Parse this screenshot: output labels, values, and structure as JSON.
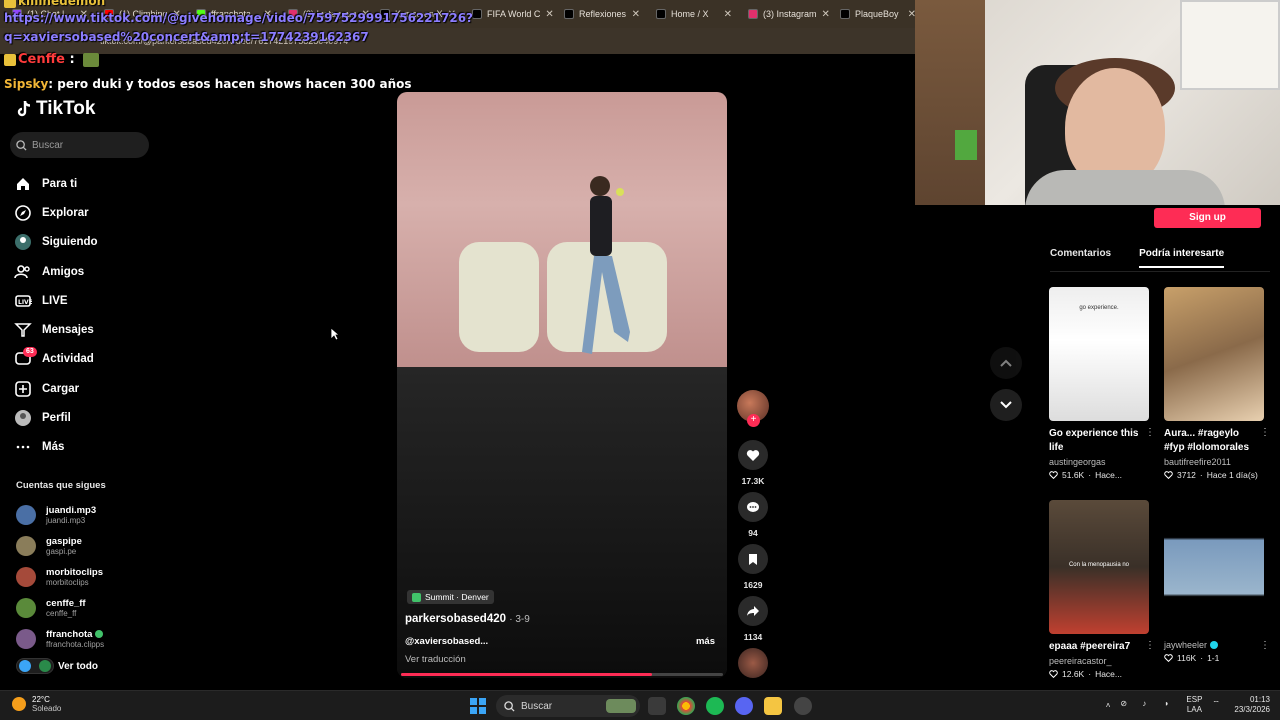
{
  "browser": {
    "tabs": [
      {
        "label": "(1) Chat | ...",
        "color": "#9147ff"
      },
      {
        "label": "(1) Climbing",
        "color": "#ff0000"
      },
      {
        "label": "ffranchota",
        "color": "#53fc18"
      },
      {
        "label": "(3) Instagram",
        "color": "#e1306c"
      },
      {
        "label": "Kurrco on X",
        "color": "#000000"
      },
      {
        "label": "FIFA World C",
        "color": "#000000"
      },
      {
        "label": "Reflexiones",
        "color": "#000000"
      },
      {
        "label": "Home / X",
        "color": "#000000"
      },
      {
        "label": "(3) Instagram",
        "color": "#e1306c"
      },
      {
        "label": "PlaqueBoy",
        "color": "#000000"
      }
    ],
    "url": "tiktok.com/@parkersobased420/video/7617421975828040974"
  },
  "chat": {
    "top_user": "kiiiinedemon",
    "url_line1": "https://www.tiktok.com/@givehomage/video/7597529991756221726?",
    "url_line2": "q=xaviersobased%20concert&amp;t=1774239162367",
    "line3_user": "Cenffe",
    "line3_sep": ":",
    "line4_user": "Sipsky",
    "line4_msg": ": pero duki y todos esos hacen shows hacen 300 años"
  },
  "tiktok": {
    "logo": "TikTok",
    "search_placeholder": "Buscar",
    "nav": [
      {
        "label": "Para ti",
        "icon": "home-icon"
      },
      {
        "label": "Explorar",
        "icon": "compass-icon"
      },
      {
        "label": "Siguiendo",
        "icon": "following-icon"
      },
      {
        "label": "Amigos",
        "icon": "friends-icon"
      },
      {
        "label": "LIVE",
        "icon": "live-icon"
      },
      {
        "label": "Mensajes",
        "icon": "messages-icon"
      },
      {
        "label": "Actividad",
        "icon": "activity-icon",
        "badge": "63"
      },
      {
        "label": "Cargar",
        "icon": "upload-icon"
      },
      {
        "label": "Perfil",
        "icon": "profile-icon"
      },
      {
        "label": "Más",
        "icon": "more-icon"
      }
    ],
    "following_title": "Cuentas que sigues",
    "following": [
      {
        "name": "juandi.mp3",
        "handle": "juandi.mp3"
      },
      {
        "name": "gaspipe",
        "handle": "gaspi.pe"
      },
      {
        "name": "morbitoclips",
        "handle": "morbitoclips"
      },
      {
        "name": "cenffe_ff",
        "handle": "cenffe_ff"
      },
      {
        "name": "ffranchota",
        "handle": "ffranchota.clipps"
      }
    ],
    "see_all": "Ver todo"
  },
  "video": {
    "location": "Summit · Denver",
    "author": "parkersobased420",
    "date": "· 3-9",
    "caption": "@xaviersobased...",
    "more": "más",
    "translate": "Ver traducción",
    "progress": 0.78
  },
  "actions": {
    "likes": "17.3K",
    "comments": "94",
    "saves": "1629",
    "shares": "1134"
  },
  "right_panel": {
    "signup": "Sign up",
    "tabs": [
      "Comentarios",
      "Podría interesarte"
    ],
    "cards": [
      {
        "title": "Go experience this life",
        "author": "austingeorgas",
        "likes": "51.6K",
        "time": "Hace...",
        "overlay": "go experience."
      },
      {
        "title": "Aura... #rageylo #fyp #lolomorales",
        "author": "bautifreefire2011",
        "likes": "3712",
        "time": "Hace 1 día(s)"
      },
      {
        "title": "epaaa #peereira7",
        "author": "peereiracastor_",
        "likes": "12.6K",
        "time": "Hace...",
        "overlay": "Con la menopausia no"
      },
      {
        "title": "",
        "author": "jaywheeler",
        "likes": "116K",
        "time": "1-1"
      }
    ]
  },
  "taskbar": {
    "temp": "22°C",
    "weather": "Soleado",
    "search": "Buscar",
    "lang1": "ESP",
    "lang2": "LAA",
    "time": "01:13",
    "date": "23/3/2026"
  }
}
